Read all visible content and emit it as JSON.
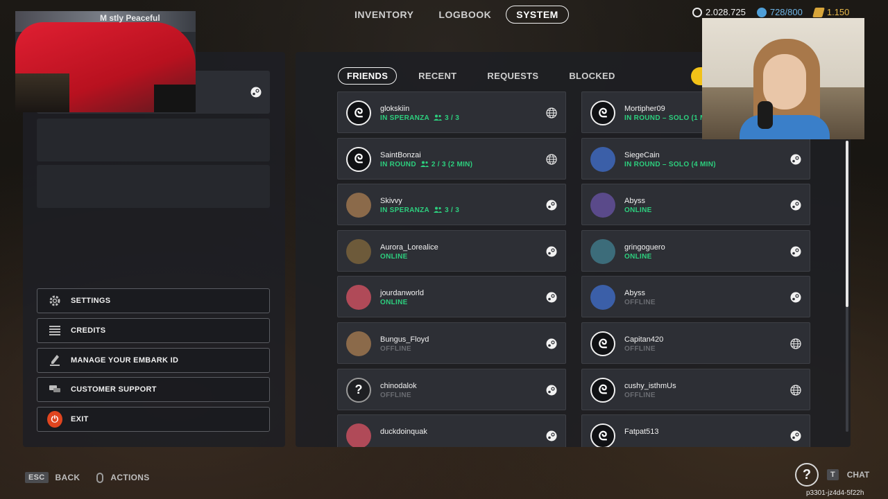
{
  "nav": {
    "tabs": [
      {
        "label": "INVENTORY",
        "active": false
      },
      {
        "label": "LOGBOOK",
        "active": false
      },
      {
        "label": "SYSTEM",
        "active": true
      }
    ]
  },
  "currencies": {
    "coins": "2.028.725",
    "tokens": "728/800",
    "raider": "1.150"
  },
  "left_menu": {
    "settings": "SETTINGS",
    "credits": "CREDITS",
    "manage_id": "MANAGE YOUR EMBARK ID",
    "support": "CUSTOMER SUPPORT",
    "exit": "EXIT"
  },
  "friend_tabs": [
    {
      "label": "FRIENDS",
      "active": true
    },
    {
      "label": "RECENT",
      "active": false
    },
    {
      "label": "REQUESTS",
      "active": false
    },
    {
      "label": "BLOCKED",
      "active": false
    }
  ],
  "friends": [
    {
      "name": "glokskiin",
      "status": "IN SPERANZA",
      "party": "3 / 3",
      "state": "online",
      "platform": "globe-icon",
      "avatar": "embark"
    },
    {
      "name": "Mortipher09",
      "status": "IN ROUND – SOLO (1 MIN)",
      "party": "",
      "state": "online",
      "platform": "steam-icon",
      "avatar": "embark"
    },
    {
      "name": "SaintBonzai",
      "status": "IN ROUND",
      "party": "2 / 3 (2 MIN)",
      "state": "online",
      "platform": "globe-icon",
      "avatar": "embark"
    },
    {
      "name": "SiegeCain",
      "status": "IN ROUND – SOLO (4 MIN)",
      "party": "",
      "state": "online",
      "platform": "steam-icon",
      "avatar": "image"
    },
    {
      "name": "Skivvy",
      "status": "IN SPERANZA",
      "party": "3 / 3",
      "state": "online",
      "platform": "steam-icon",
      "avatar": "image"
    },
    {
      "name": "Abyss",
      "status": "ONLINE",
      "party": "",
      "state": "online",
      "platform": "steam-icon",
      "avatar": "image"
    },
    {
      "name": "Aurora_Lorealice",
      "status": "ONLINE",
      "party": "",
      "state": "online",
      "platform": "steam-icon",
      "avatar": "image"
    },
    {
      "name": "gringoguero",
      "status": "ONLINE",
      "party": "",
      "state": "online",
      "platform": "steam-icon",
      "avatar": "image"
    },
    {
      "name": "jourdanworld",
      "status": "ONLINE",
      "party": "",
      "state": "online",
      "platform": "steam-icon",
      "avatar": "image"
    },
    {
      "name": "Abyss",
      "status": "OFFLINE",
      "party": "",
      "state": "offline",
      "platform": "steam-icon",
      "avatar": "image"
    },
    {
      "name": "Bungus_Floyd",
      "status": "OFFLINE",
      "party": "",
      "state": "offline",
      "platform": "steam-icon",
      "avatar": "image"
    },
    {
      "name": "Capitan420",
      "status": "OFFLINE",
      "party": "",
      "state": "offline",
      "platform": "globe-icon",
      "avatar": "embark"
    },
    {
      "name": "chinodalok",
      "status": "OFFLINE",
      "party": "",
      "state": "offline",
      "platform": "steam-icon",
      "avatar": "help"
    },
    {
      "name": "cushy_isthmUs",
      "status": "OFFLINE",
      "party": "",
      "state": "offline",
      "platform": "globe-icon",
      "avatar": "embark"
    },
    {
      "name": "duckdoinquak",
      "status": "",
      "party": "",
      "state": "offline",
      "platform": "steam-icon",
      "avatar": "image"
    },
    {
      "name": "Fatpat513",
      "status": "",
      "party": "",
      "state": "offline",
      "platform": "steam-icon",
      "avatar": "embark"
    }
  ],
  "stream": {
    "title": "M stly Peaceful"
  },
  "bottom": {
    "esc_key": "ESC",
    "back": "BACK",
    "actions": "ACTIONS",
    "chat_key": "T",
    "chat": "CHAT",
    "session_id": "p3301-jz4d4-5f22h"
  },
  "colors": {
    "online": "#2dcf7e",
    "offline": "#6a6c72",
    "exit": "#e0451f",
    "accent_yellow": "#f2c218"
  }
}
